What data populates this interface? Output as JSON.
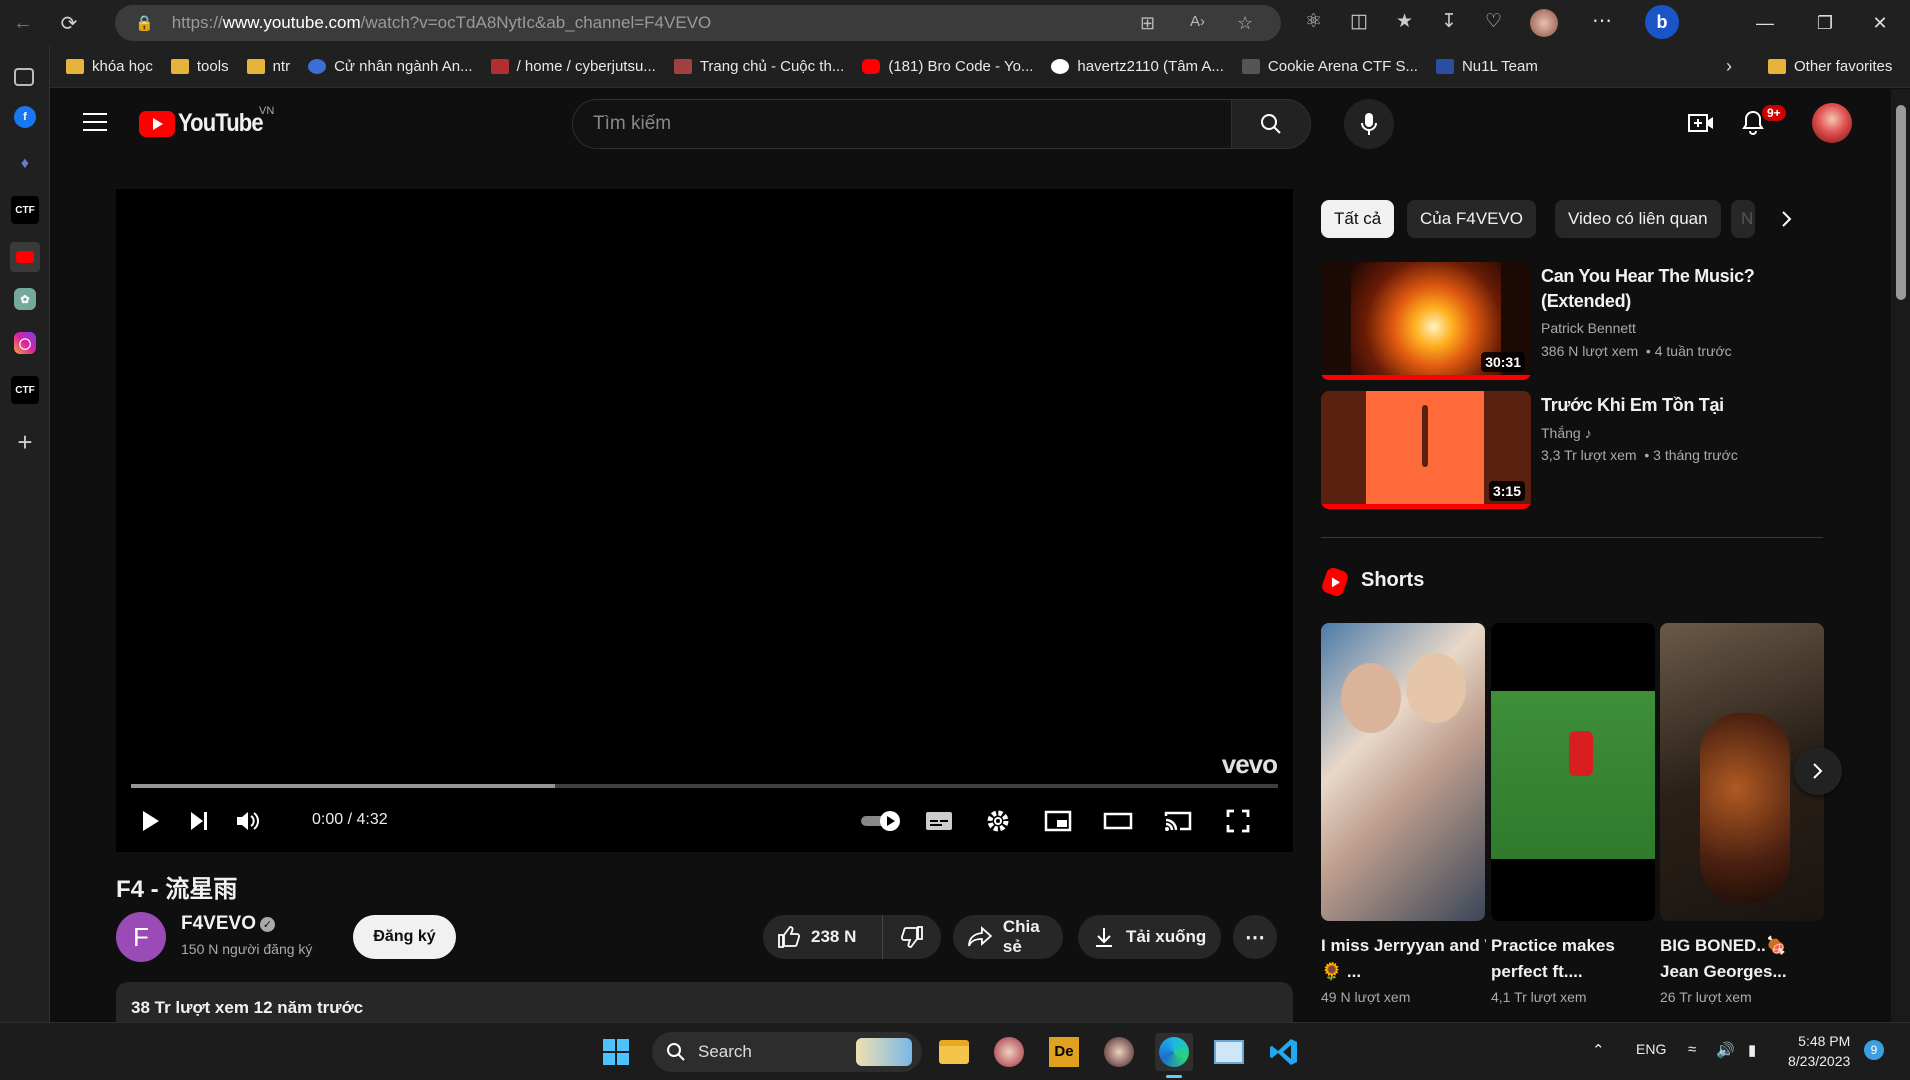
{
  "browser": {
    "url_prefix": "https://",
    "url_domain": "www.youtube.com",
    "url_rest": "/watch?v=ocTdA8NytIc&ab_channel=F4VEVO",
    "bookmarks": [
      {
        "label": "khóa học",
        "kind": "folder"
      },
      {
        "label": "tools",
        "kind": "folder"
      },
      {
        "label": "ntr",
        "kind": "folder"
      },
      {
        "label": "Cử nhân ngành An...",
        "kind": "site",
        "color": "#3b6fd6"
      },
      {
        "label": "/ home / cyberjutsu...",
        "kind": "site",
        "color": "#b03030"
      },
      {
        "label": "Trang chủ - Cuộc th...",
        "kind": "site",
        "color": "#a04040"
      },
      {
        "label": "(181) Bro Code - Yo...",
        "kind": "site",
        "color": "#ff0000"
      },
      {
        "label": "havertz2110 (Tâm A...",
        "kind": "site",
        "color": "#ffffff"
      },
      {
        "label": "Cookie Arena CTF S...",
        "kind": "site",
        "color": "#666666"
      },
      {
        "label": "Nu1L Team",
        "kind": "site",
        "color": "#2a4fa0"
      }
    ],
    "other_favorites": "Other favorites"
  },
  "youtube": {
    "logo_text": "YouTube",
    "logo_region": "VN",
    "search_placeholder": "Tìm kiếm",
    "notification_count": "9+"
  },
  "player": {
    "watermark": "vevo",
    "time_current": "0:00",
    "time_separator": " / ",
    "time_total": "4:32",
    "progress_fraction": 0,
    "buffered_fraction": 0.37
  },
  "video": {
    "title": "F4 - 流星雨",
    "channel_initial": "F",
    "channel_name": "F4VEVO",
    "subscribers": "150 N người đăng ký",
    "subscribe_label": "Đăng ký",
    "likes": "238 N",
    "share_label": "Chia sẻ",
    "download_label": "Tải xuống",
    "description_summary": "38 Tr lượt xem  12 năm trước"
  },
  "chips": [
    "Tất cả",
    "Của F4VEVO",
    "Video có liên quan",
    "N"
  ],
  "recommendations": [
    {
      "title": "Can You Hear The Music? (Extended)",
      "channel": "Patrick Bennett",
      "views": "386 N lượt xem",
      "age": "4 tuần trước",
      "duration": "30:31",
      "watched_fraction": 1.0
    },
    {
      "title": "Trước Khi Em Tồn Tại",
      "channel": "Thắng",
      "views": "3,3 Tr lượt xem",
      "age": "3 tháng trước",
      "duration": "3:15",
      "watched_fraction": 1.0
    }
  ],
  "shorts": {
    "heading": "Shorts",
    "items": [
      {
        "title_line1": "I miss Jerryyan and V",
        "title_line2": "🌻 ...",
        "views": "49 N lượt xem"
      },
      {
        "title_line1": "Practice makes",
        "title_line2": "perfect ft....",
        "views": "4,1 Tr lượt xem"
      },
      {
        "title_line1": "BIG BONED..🍖",
        "title_line2": "Jean Georges...",
        "views": "26 Tr lượt xem"
      }
    ]
  },
  "taskbar": {
    "search_label": "Search",
    "language": "ENG",
    "time": "5:48 PM",
    "date": "8/23/2023",
    "notification_count": "9"
  }
}
